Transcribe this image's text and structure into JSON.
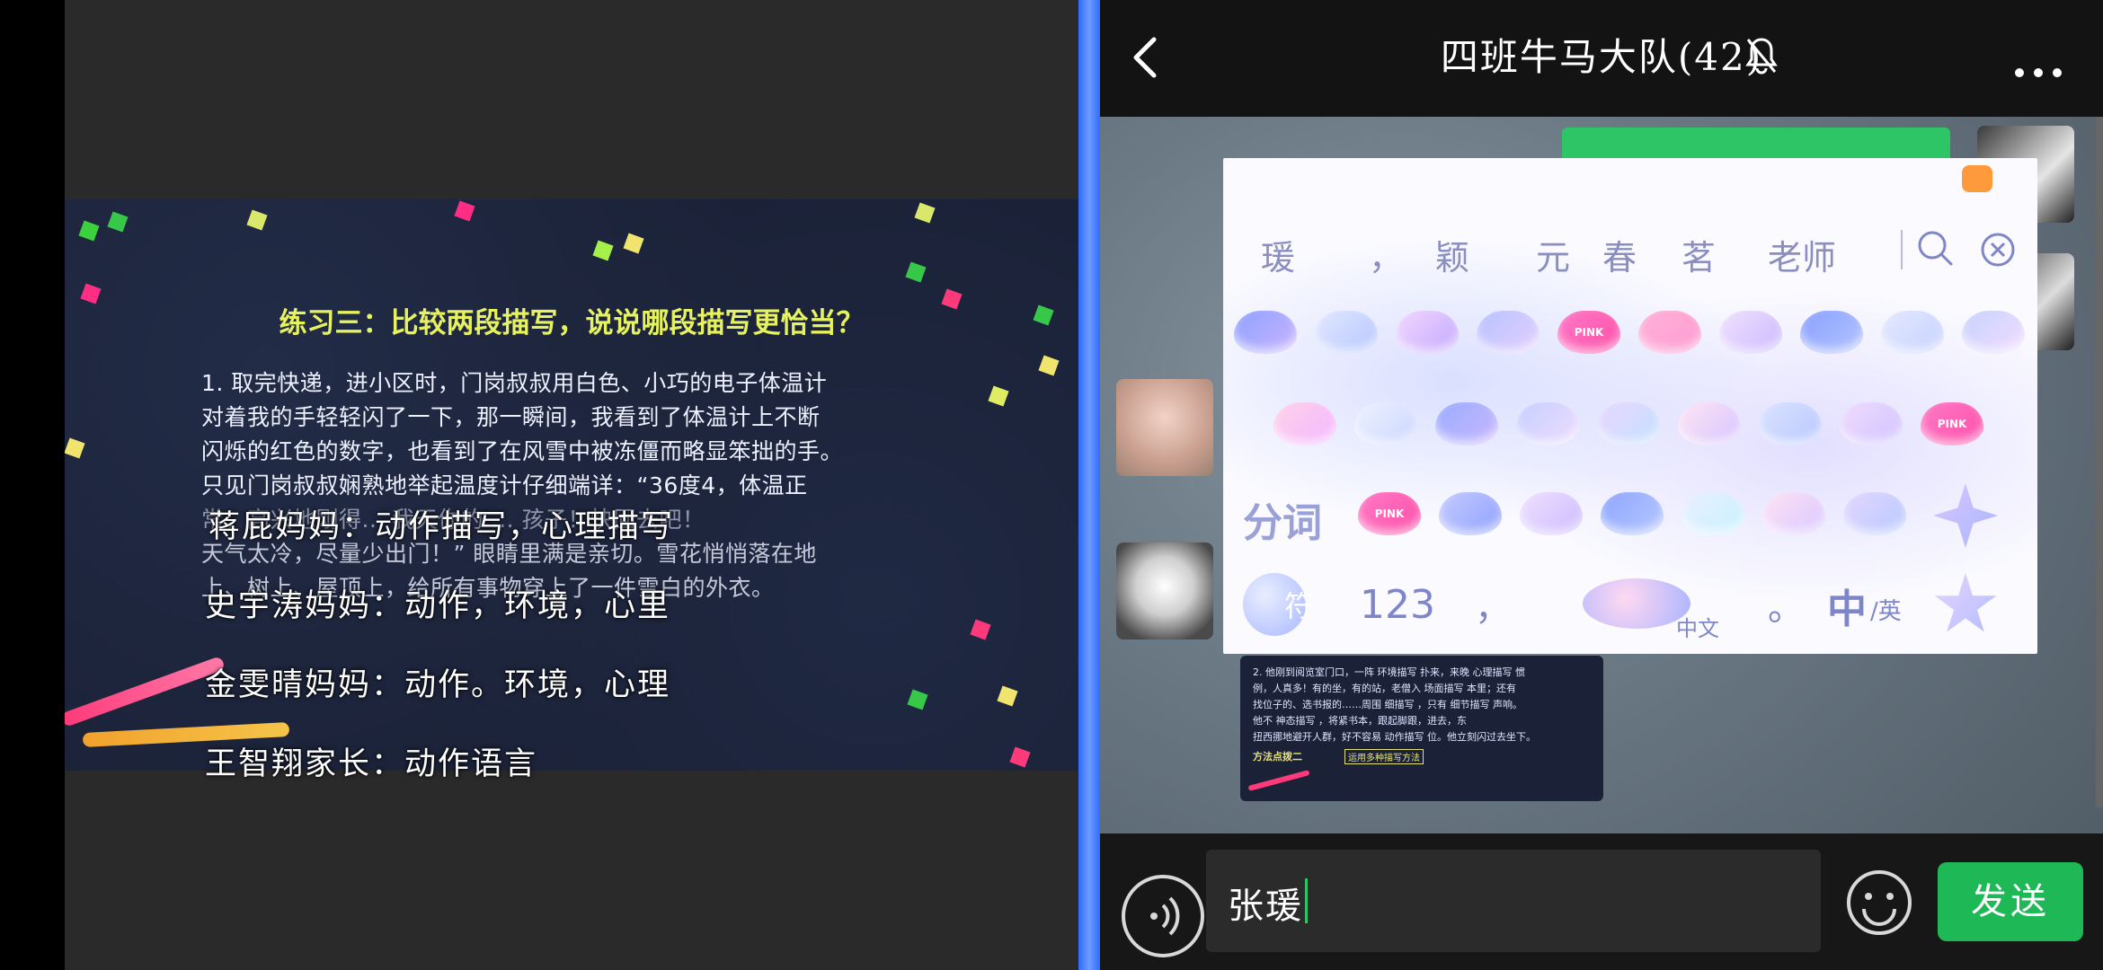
{
  "slide": {
    "title": "练习三：比较两段描写，说说哪段描写更恰当？",
    "lines": [
      "1. 取完快递，进小区时，门岗叔叔用白色、小巧的电子体温计",
      "对着我的手轻轻闪了一下，那一瞬间，我看到了体温计上不断",
      "闪烁的红色的数字，也看到了在风雪中被冻僵而略显笨拙的手。",
      "只见门岗叔叔娴熟地举起温度计仔细端详：“36度4，体温正",
      "常，高兴地刚得... 我天你的 ... 孩子！快回去吧！",
      "天气太冷，尽量少出门！” 眼睛里满是亲切。雪花悄悄落在地",
      "上、树上、屋顶上，给所有事物穿上了一件雪白的外衣。"
    ],
    "overlays": [
      "蒋屁妈妈：动作描写，心理描写",
      "史宇涛妈妈：动作，环境，心里",
      "金雯晴妈妈：动作。环境，心理",
      "王智翔家长：动作语言"
    ]
  },
  "chat": {
    "title": "四班牛马大队(42)",
    "input_value": "张瑗",
    "send_label": "发送"
  },
  "keyboard": {
    "candidates": [
      "瑗",
      "，",
      "颖",
      "元",
      "春",
      "茗",
      "老师"
    ],
    "segment_label": "分词",
    "symbol_key": "符",
    "number_key": "123",
    "comma_key": "，",
    "space_label": "中文",
    "period_key": "。",
    "lang_zh": "中",
    "lang_en": "/英",
    "pink_label": "PINK"
  },
  "thumb": {
    "line1": "2. 他刚到阅览室门口，一阵 环境描写 扑来，来晚 心理描写 惯",
    "line2": "例，人真多！有的坐，有的站，老僧入 场面描写 本里；还有",
    "line3": "找位子的、选书报的……周围 细描写 ，只有 细节描写 声响。",
    "line4": "他不 神态描写 ，将紧书本，跟起脚跟，进去，东",
    "line5": "扭西挪地避开人群，好不容易 动作描写 位。他立刻闪过去坐下。",
    "method": "方法点拨二",
    "method_tag": "运用多种描写方法"
  }
}
